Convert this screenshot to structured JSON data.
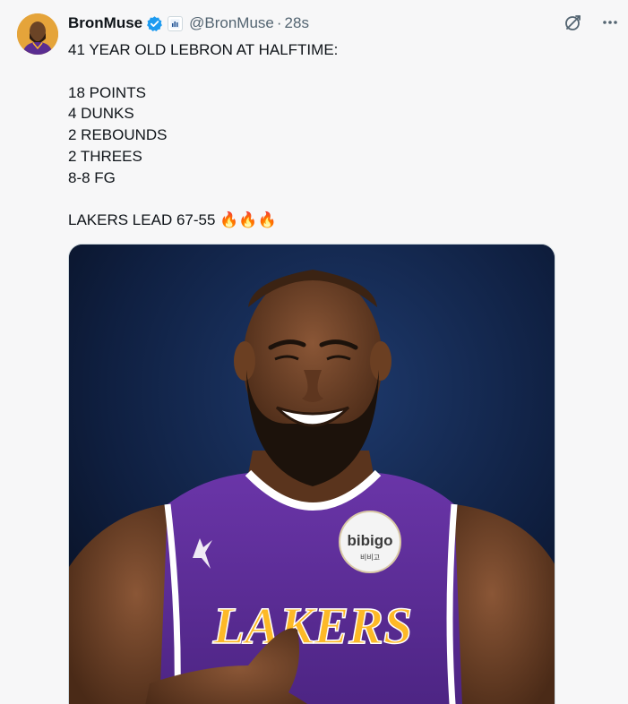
{
  "tweet": {
    "display_name": "BronMuse",
    "handle": "@BronMuse",
    "separator": "·",
    "time": "28s",
    "text_lines": [
      "41 YEAR OLD LEBRON AT HALFTIME:",
      "",
      "18 POINTS",
      "4 DUNKS",
      "2 REBOUNDS",
      "2 THREES",
      "8-8 FG",
      "",
      "LAKERS LEAD 67-55 🔥🔥🔥"
    ]
  },
  "media": {
    "jersey_wordmark": "LAKERS",
    "sponsor_patch": "bibigo",
    "sponsor_patch_sub": "비비고"
  },
  "icons": {
    "verified": "verified-badge-icon",
    "affiliation": "affiliate-badge-icon",
    "grok": "grok-icon",
    "more": "more-icon"
  },
  "colors": {
    "accent": "#1d9bf0",
    "secondary_text": "#536471",
    "jersey_purple": "#5a2d91",
    "jersey_gold": "#fdb927"
  }
}
